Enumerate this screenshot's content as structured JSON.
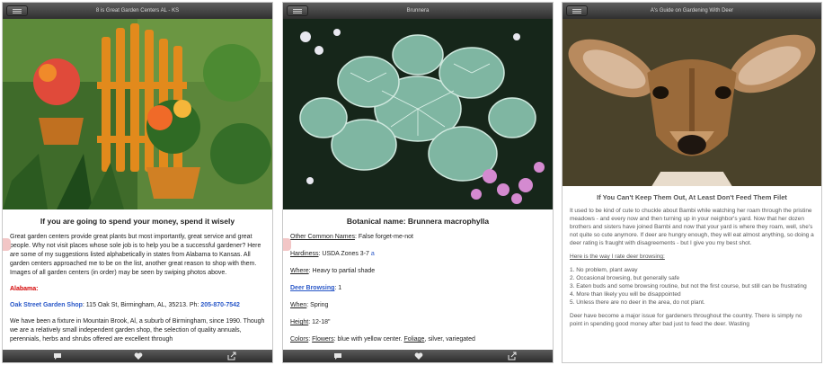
{
  "screen1": {
    "title": "8 is Great Garden Centers AL - KS",
    "heading": "If you are going to spend your money, spend it wisely",
    "intro": "Great garden centers provide great plants but most importantly, great service and great people. Why not visit places whose sole job is to help you be a successful gardener? Here are some of my suggestions listed alphabetically in states from Alabama to Kansas. All garden centers approached me to be on the list, another great reason to shop with them. Images of all garden centers (in order) may be seen by swiping photos above.",
    "state": "Alabama:",
    "shop_name": "Oak Street Garden Shop",
    "shop_address": ": 115 Oak St, Birmingham, AL, 35213. Ph: ",
    "shop_phone": "205-870-7542",
    "body": "We have been a fixture in Mountain Brook, Al, a suburb of Birmingham, since 1990. Though we are a relatively small independent garden shop, the selection of quality annuals, perennials, herbs and shrubs offered are excellent through"
  },
  "screen2": {
    "title": "Brunnera",
    "heading": "Botanical name: Brunnera macrophylla",
    "common_label": "Other Common Names",
    "common_value": ": False forget-me-not",
    "hardiness_label": "Hardiness",
    "hardiness_value": ": USDA Zones 3-7 ",
    "hardiness_link": "a",
    "where_label": "Where",
    "where_value": ": Heavy to partial shade",
    "deer_label": "Deer Browsing",
    "deer_value": ": 1",
    "when_label": "When",
    "when_value": ": Spring",
    "height_label": "Height",
    "height_value": ": 12-18\"",
    "colors_label": "Colors",
    "flowers_label": "Flowers",
    "flowers_value": ": blue with yellow center. ",
    "foliage_label": "Foliage",
    "foliage_value": ", silver, variegated"
  },
  "screen3": {
    "title": "A's Guide on Gardening With Deer",
    "heading": "If You Can't Keep Them Out, At Least Don't Feed Them Filet",
    "intro": "It used to be kind of cute to chuckle about Bambi while watching her roam through the pristine meadows - and every now and then turning up in your neighbor's yard. Now that her dozen brothers and sisters have joined Bambi and now that your yard is where they roam, well, she's not quite so cute anymore. If deer are hungry enough, they will eat almost anything, so doing a deer rating is fraught with disagreements - but I give you my best shot.",
    "rate_heading": "Here is the way I rate deer browsing:",
    "ratings": [
      "1. No problem, plant away",
      "2. Occasional browsing, but generally safe",
      "3. Eaten buds and some browsing routine, but not the first course, but still can be frustrating",
      "4. More than likely you will be disappointed",
      "5. Unless there are no deer in the area, do not plant."
    ],
    "footer_text": "Deer have become a major issue for gardeners throughout the country. There is simply no point in spending good money after bad just to feed the deer. Wasting"
  },
  "toolbar": {
    "icons": [
      "speech-bubble-icon",
      "heart-icon",
      "share-icon"
    ]
  },
  "colors": {
    "link_blue": "#2a58c8",
    "heading_red": "#d40000",
    "bar_dark": "#2f2f2f"
  }
}
